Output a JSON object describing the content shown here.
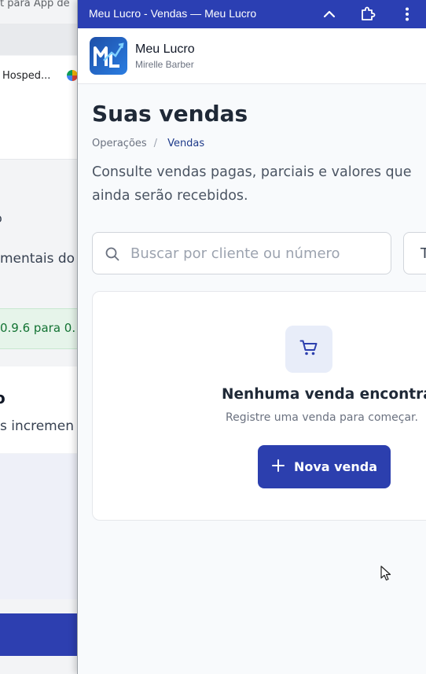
{
  "background_page": {
    "top_text": "t para App de",
    "hosp_text": "Hosped...",
    "partial_title_1": "o",
    "partial_text_1": "mentais do",
    "version_text": "0.9.6 para 0.",
    "partial_title_2": "o",
    "partial_text_2": "s incremen"
  },
  "window": {
    "title": "Meu Lucro - Vendas — Meu Lucro",
    "titlebar_color": "#2b3fb3"
  },
  "header": {
    "brand": "Meu Lucro",
    "user": "Mirelle Barber"
  },
  "page": {
    "title": "Suas vendas",
    "breadcrumb": [
      "Operações",
      "/",
      "Vendas"
    ],
    "description": "Consulte vendas pagas, parciais e valores que ainda serão recebidos."
  },
  "search": {
    "placeholder": "Buscar por cliente ou número",
    "value": ""
  },
  "filter": {
    "label": "T"
  },
  "empty_state": {
    "icon": "shopping-cart-icon",
    "title": "Nenhuma venda encontrada",
    "subtitle": "Registre uma venda para começar.",
    "button_label": "Nova venda",
    "button_icon": "plus-icon"
  },
  "colors": {
    "accent": "#2c3fae",
    "icon_bg": "#e8edf9"
  }
}
